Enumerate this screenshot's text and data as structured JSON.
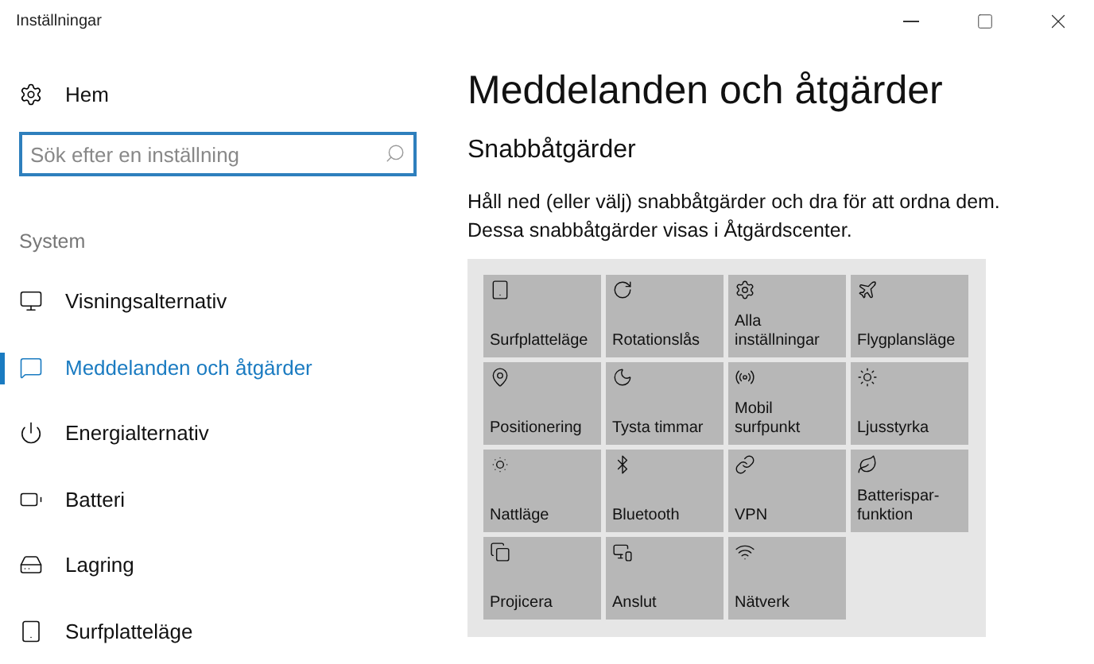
{
  "window": {
    "title": "Inställningar"
  },
  "sidebar": {
    "home": "Hem",
    "search": {
      "placeholder": "Sök efter en inställning"
    },
    "section": "System",
    "items": [
      {
        "label": "Visningsalternativ",
        "selected": false
      },
      {
        "label": "Meddelanden och åtgärder",
        "selected": true
      },
      {
        "label": "Energialternativ",
        "selected": false
      },
      {
        "label": "Batteri",
        "selected": false
      },
      {
        "label": "Lagring",
        "selected": false
      },
      {
        "label": "Surfplatteläge",
        "selected": false
      }
    ]
  },
  "content": {
    "title": "Meddelanden och åtgärder",
    "subtitle": "Snabbåtgärder",
    "description": "Håll ned (eller välj) snabbåtgärder och dra för att ordna dem. Dessa snabbåtgärder visas i Åtgärdscenter.",
    "tiles": [
      {
        "label": "Surfplatteläge"
      },
      {
        "label": "Rotationslås"
      },
      {
        "label": "Alla inställningar"
      },
      {
        "label": "Flygplansläge"
      },
      {
        "label": "Positionering"
      },
      {
        "label": "Tysta timmar"
      },
      {
        "label": "Mobil surfpunkt"
      },
      {
        "label": "Ljusstyrka"
      },
      {
        "label": "Nattläge"
      },
      {
        "label": "Bluetooth"
      },
      {
        "label": "VPN"
      },
      {
        "label": "Batterispar-funktion"
      },
      {
        "label": "Projicera"
      },
      {
        "label": "Anslut"
      },
      {
        "label": "Nätverk"
      }
    ]
  }
}
